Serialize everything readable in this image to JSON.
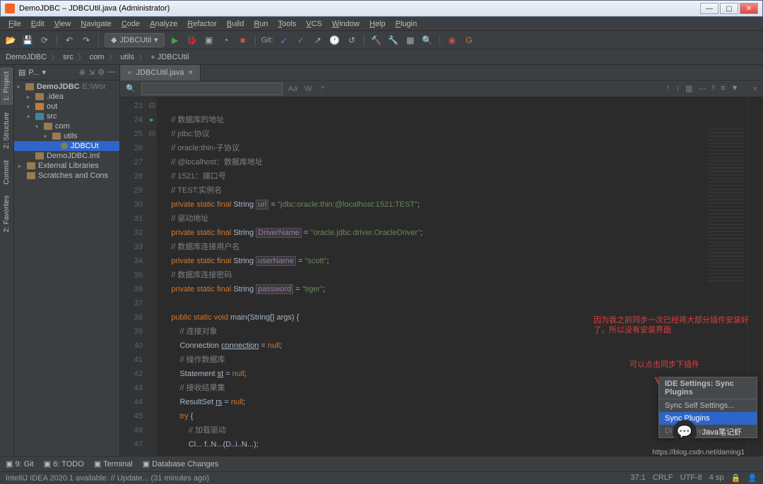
{
  "title": "DemoJDBC – JDBCUtil.java (Administrator)",
  "menu": [
    "File",
    "Edit",
    "View",
    "Navigate",
    "Code",
    "Analyze",
    "Refactor",
    "Build",
    "Run",
    "Tools",
    "VCS",
    "Window",
    "Help",
    "Plugin"
  ],
  "toolbar": {
    "config": "JDBCUtil",
    "git_label": "Git:"
  },
  "breadcrumb": [
    "DemoJDBC",
    "src",
    "com",
    "utils",
    "JDBCUtil"
  ],
  "project": {
    "header": "P...",
    "root": "DemoJDBC",
    "root_path": "E:\\Wor",
    "items": [
      {
        "indent": 1,
        "arrow": "▸",
        "icon": "fico",
        "label": ".idea"
      },
      {
        "indent": 1,
        "arrow": "▾",
        "icon": "fico ora",
        "label": "out"
      },
      {
        "indent": 1,
        "arrow": "▾",
        "icon": "fico blue",
        "label": "src"
      },
      {
        "indent": 2,
        "arrow": "▾",
        "icon": "fico",
        "label": "com"
      },
      {
        "indent": 3,
        "arrow": "▾",
        "icon": "fico",
        "label": "utils"
      },
      {
        "indent": 4,
        "arrow": "",
        "icon": "pico",
        "label": "JDBCUt",
        "sel": true
      },
      {
        "indent": 1,
        "arrow": "",
        "icon": "fico",
        "label": "DemoJDBC.iml"
      },
      {
        "indent": 0,
        "arrow": "▸",
        "icon": "fico",
        "label": "External Libraries"
      },
      {
        "indent": 0,
        "arrow": "",
        "icon": "fico",
        "label": "Scratches and Cons"
      }
    ]
  },
  "tab": {
    "name": "JDBCUtil.java"
  },
  "find": {
    "placeholder": "",
    "opts": [
      "Aa",
      "W",
      ".*"
    ]
  },
  "code_lines": [
    {
      "n": 23,
      "html": ""
    },
    {
      "n": 24,
      "html": "    <span class='cmt'>// 数据库的地址</span>"
    },
    {
      "n": 25,
      "html": "    <span class='cmt'>// jdbc:协议</span>"
    },
    {
      "n": 26,
      "html": "    <span class='cmt'>// oracle:thin-子协议</span>"
    },
    {
      "n": 27,
      "html": "    <span class='cmt'>// @localhost：数据库地址</span>"
    },
    {
      "n": 28,
      "html": "    <span class='cmt'>// 1521：端口号</span>"
    },
    {
      "n": 29,
      "html": "    <span class='cmt'>// TEST:实例名</span>"
    },
    {
      "n": 30,
      "html": "    <span class='kw'>private</span> <span class='kw'>static</span> <span class='kw'>final</span> String <span class='box gray id'>url</span> = <span class='str'>\"jdbc:oracle:thin:@localhost:1521:TEST\"</span>;"
    },
    {
      "n": 31,
      "html": "    <span class='cmt'>// 驱动地址</span>"
    },
    {
      "n": 32,
      "html": "    <span class='kw'>private</span> <span class='kw'>static</span> <span class='kw'>final</span> String <span class='box gray id'>DriverName</span> = <span class='str'>\"oracle.jdbc.driver.OracleDriver\"</span>;"
    },
    {
      "n": 33,
      "html": "    <span class='cmt'>// 数据库连接用户名</span>"
    },
    {
      "n": 34,
      "html": "    <span class='kw'>private</span> <span class='kw'>static</span> <span class='kw'>final</span> String <span class='box gray id'>userName</span> = <span class='str'>\"scott\"</span>;"
    },
    {
      "n": 35,
      "html": "    <span class='cmt'>// 数据库连接密码</span>"
    },
    {
      "n": 36,
      "html": "    <span class='kw'>private</span> <span class='kw'>static</span> <span class='kw'>final</span> String <span class='box gray id'>password</span> = <span class='str'>\"tiger\"</span>;"
    },
    {
      "n": 37,
      "html": ""
    },
    {
      "n": 38,
      "html": "    <span class='kw'>public</span> <span class='kw'>static</span> <span class='kw'>void</span> main(String[] args) {",
      "play": true
    },
    {
      "n": 39,
      "html": "        <span class='cmt'>// 连接对象</span>"
    },
    {
      "n": 40,
      "html": "        Connection <u>connection</u> = <span class='kw'>null</span>;"
    },
    {
      "n": 41,
      "html": "        <span class='cmt'>// 操作数据库</span>"
    },
    {
      "n": 42,
      "html": "        Statement <u>st</u> = <span class='kw'>null</span>;"
    },
    {
      "n": 43,
      "html": "        <span class='cmt'>// 接收结果集</span>"
    },
    {
      "n": 44,
      "html": "        ResultSet <u>rs</u> = <span class='kw'>null</span>;"
    },
    {
      "n": 45,
      "html": "        <span class='kw'>try</span> {"
    },
    {
      "n": 46,
      "html": "            <span class='cmt'>// 加载驱动</span>"
    },
    {
      "n": 47,
      "html": "            Cl... f..N...(D..i..N...);"
    }
  ],
  "left_tabs": [
    "1: Project",
    "2: Structure",
    "Commit",
    "2: Favorites"
  ],
  "status": {
    "items": [
      "9: Git",
      "6: TODO",
      "Terminal",
      "Database Changes"
    ],
    "pos": "37:1",
    "enc": "CRLF",
    "charset": "UTF-8",
    "spaces": "4 sp"
  },
  "update": "IntelliJ IDEA 2020.1 available: // Update... (31 minutes ago)",
  "ctxmenu": {
    "header": "IDE Settings: Sync Plugins",
    "items": [
      "Sync Self Settings...",
      "Sync Plugins",
      "Disable Sync..."
    ],
    "sel": 1
  },
  "annotations": {
    "a1_l1": "因为我之前同步一次已经将大部分插件安装好",
    "a1_l2": "了，所以没有安装界面",
    "a2": "可以点击同步下插件"
  },
  "watermark": {
    "text": "Java笔记虾",
    "url": "https://blog.csdn.net/daming1"
  }
}
